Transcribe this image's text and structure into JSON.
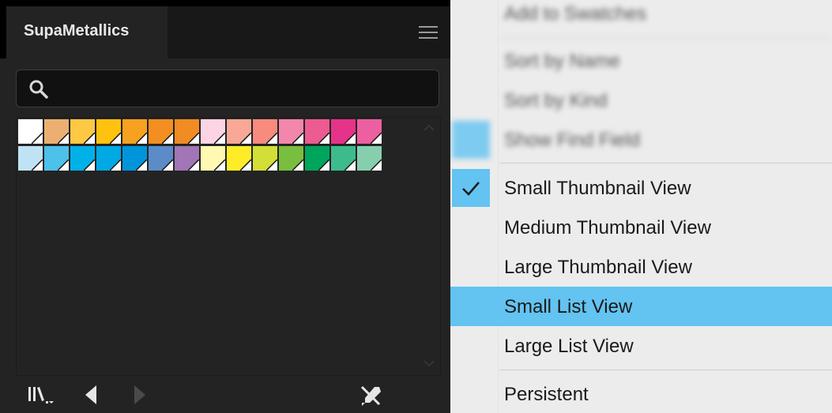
{
  "panel": {
    "title": "SupaMetallics",
    "search": {
      "value": "",
      "placeholder": ""
    },
    "swatch_rows": [
      [
        "#ffffff",
        "#ebb071",
        "#fdc843",
        "#ffc20f",
        "#f6a121",
        "#f38f22",
        "#f18b23",
        "#fdd4e3",
        "#f9a897",
        "#f68b7e",
        "#f287ab",
        "#ec5b91",
        "#e6338a",
        "#ec5fa0"
      ],
      [
        "#bfe3f5",
        "#4dc1e9",
        "#00b1e8",
        "#00a9e4",
        "#0095da",
        "#5b8cc8",
        "#a275b6",
        "#fff9b4",
        "#ffec29",
        "#d3de37",
        "#7abe40",
        "#00a55c",
        "#3dbb8d",
        "#86cfae"
      ]
    ]
  },
  "context_menu": {
    "blurred_items": [
      "Add to Swatches",
      "Sort by Name",
      "Sort by Kind",
      "Show Find Field"
    ],
    "items": [
      {
        "label": "Small Thumbnail View",
        "checked": true,
        "highlighted": false
      },
      {
        "label": "Medium Thumbnail View",
        "checked": false,
        "highlighted": false
      },
      {
        "label": "Large Thumbnail View",
        "checked": false,
        "highlighted": false
      },
      {
        "label": "Small List View",
        "checked": false,
        "highlighted": true
      },
      {
        "label": "Large List View",
        "checked": false,
        "highlighted": false
      }
    ],
    "persistent_label": "Persistent",
    "highlight_color": "#63c3f1"
  }
}
